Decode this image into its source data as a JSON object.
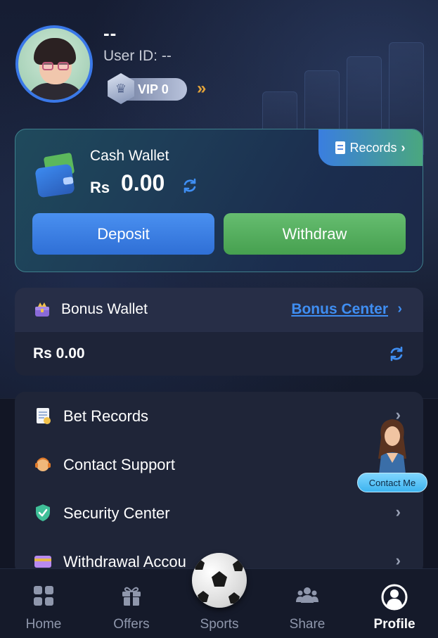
{
  "header": {
    "username": "--",
    "user_id": "User ID: --",
    "vip_label": "VIP 0",
    "vip_arrows": "»"
  },
  "cash_wallet": {
    "records_label": "Records",
    "title": "Cash Wallet",
    "currency": "Rs",
    "amount": "0.00",
    "deposit_label": "Deposit",
    "withdraw_label": "Withdraw"
  },
  "bonus_wallet": {
    "title": "Bonus Wallet",
    "link_label": "Bonus Center",
    "amount": "Rs 0.00"
  },
  "menu": [
    {
      "label": "Bet Records",
      "icon": "receipt-icon"
    },
    {
      "label": "Contact Support",
      "icon": "support-agent-icon"
    },
    {
      "label": "Security Center",
      "icon": "shield-icon"
    },
    {
      "label": "Withdrawal Accou",
      "icon": "card-icon"
    }
  ],
  "contact_me": {
    "label": "Contact Me"
  },
  "nav": [
    {
      "label": "Home",
      "icon": "home-grid-icon"
    },
    {
      "label": "Offers",
      "icon": "gift-icon"
    },
    {
      "label": "Sports",
      "icon": "soccer-ball-icon"
    },
    {
      "label": "Share",
      "icon": "users-icon"
    },
    {
      "label": "Profile",
      "icon": "profile-icon",
      "active": true
    }
  ],
  "colors": {
    "background": "#121625",
    "deposit": "#3a82e6",
    "withdraw": "#58b062",
    "link": "#3f8ef2",
    "nav_inactive": "#8f97ac"
  }
}
